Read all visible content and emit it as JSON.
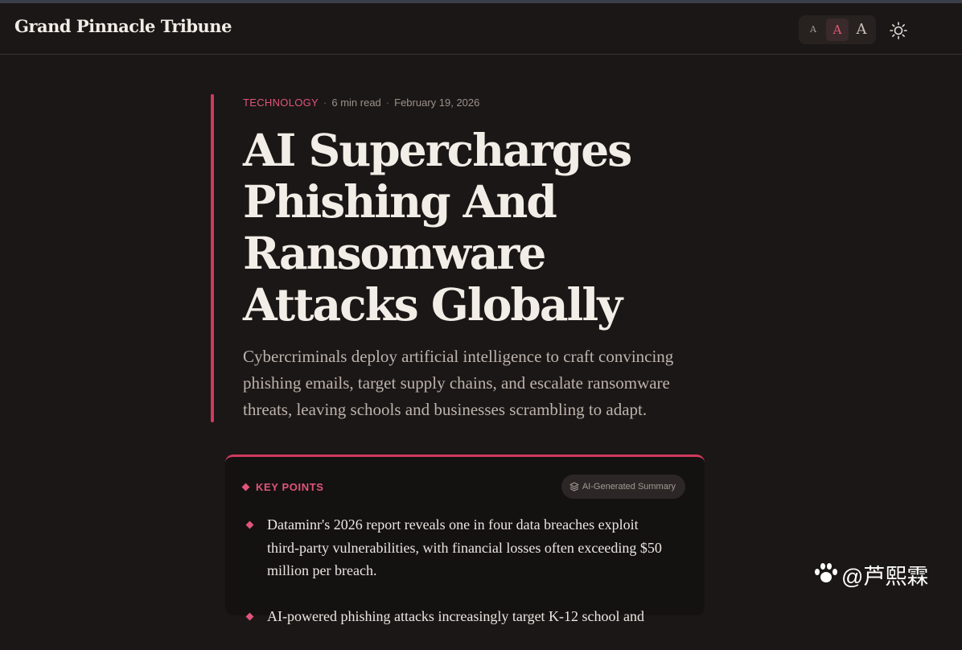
{
  "header": {
    "brand": "Grand Pinnacle Tribune",
    "font_size_controls": [
      "A",
      "A",
      "A"
    ],
    "active_font_size": "medium",
    "theme_toggle_icon": "sun-icon"
  },
  "article": {
    "category": "TECHNOLOGY",
    "read_time": "6 min read",
    "date": "February 19, 2026",
    "title": "AI Supercharges Phishing And Ransomware Attacks Globally",
    "dek": "Cybercriminals deploy artificial intelligence to craft convincing phishing emails, target supply chains, and escalate ransomware threats, leaving schools and businesses scrambling to adapt."
  },
  "key_points": {
    "title": "KEY POINTS",
    "badge": "AI-Generated Summary",
    "items": [
      "Dataminr's 2026 report reveals one in four data breaches exploit third-party vulnerabilities, with financial losses often exceeding $50 million per breach.",
      "AI-powered phishing attacks increasingly target K-12 school and"
    ]
  },
  "watermark": "@芦熙霖",
  "colors": {
    "accent": "#d03a5e",
    "background": "#1b1716",
    "text": "#f3ede7"
  }
}
